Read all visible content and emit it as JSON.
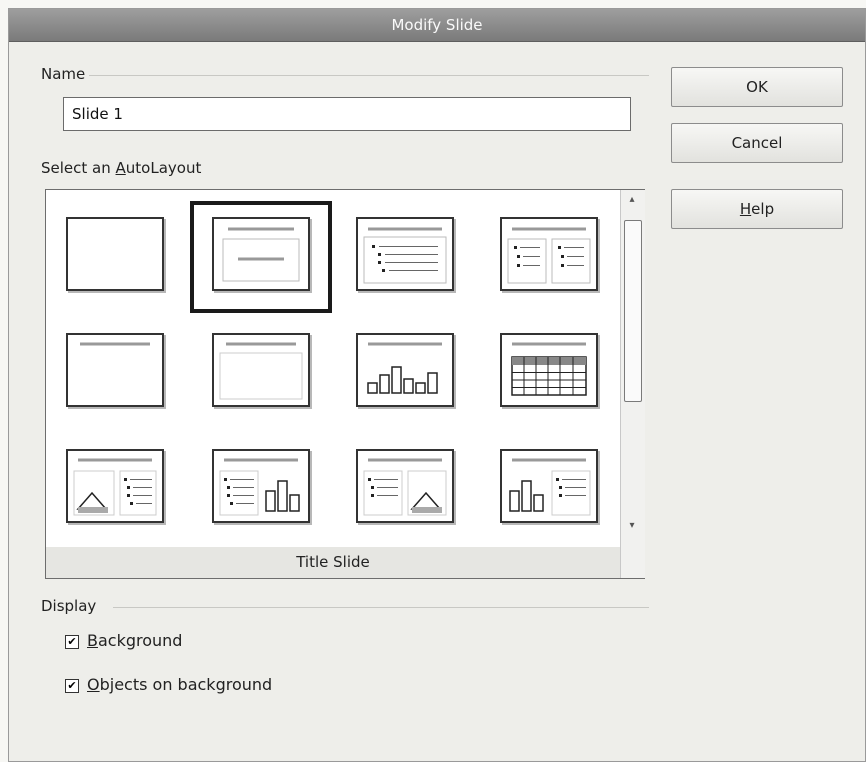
{
  "dialog": {
    "title": "Modify Slide"
  },
  "name_section": {
    "label": "Name",
    "value": "Slide 1"
  },
  "buttons": {
    "ok": "OK",
    "cancel": "Cancel",
    "help_mnemonic": "H",
    "help_rest": "elp"
  },
  "autolayout": {
    "label_prefix": "Select an ",
    "label_mnemonic": "A",
    "label_rest": "utoLayout",
    "selected_caption": "Title Slide",
    "selected_index": 1,
    "layout_icons": [
      "blank-layout-icon",
      "title-slide-layout-icon",
      "title-content-layout-icon",
      "title-two-columns-layout-icon",
      "title-only-layout-icon",
      "centered-text-layout-icon",
      "title-chart-layout-icon",
      "title-spreadsheet-layout-icon",
      "title-clipart-text-layout-icon",
      "title-text-chart-layout-icon",
      "title-text-clipart-layout-icon",
      "title-chart-text-layout-icon"
    ]
  },
  "display": {
    "label": "Display",
    "background": {
      "mnemonic": "B",
      "rest": "ackground",
      "checked": true
    },
    "objects": {
      "mnemonic": "O",
      "rest": "bjects on background",
      "checked": true
    }
  },
  "check_glyph": "✔"
}
